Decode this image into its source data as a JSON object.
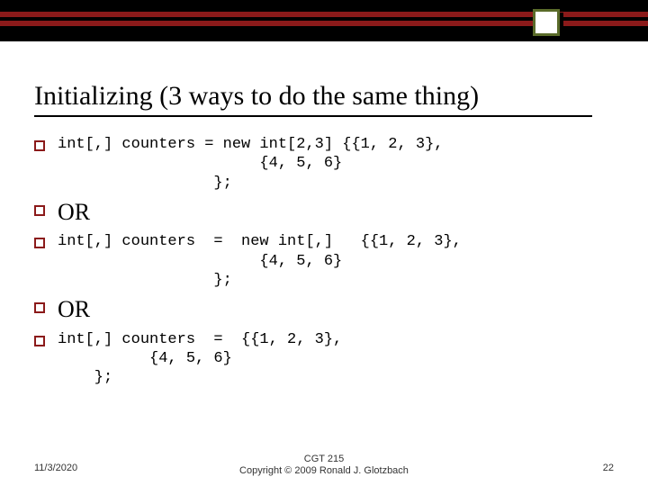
{
  "title": "Initializing (3 ways to do the same thing)",
  "items": [
    {
      "type": "code",
      "text": "int[,] counters = new int[2,3] {{1, 2, 3},\n                      {4, 5, 6}\n                 };"
    },
    {
      "type": "or",
      "text": "OR"
    },
    {
      "type": "code",
      "text": "int[,] counters  =  new int[,]   {{1, 2, 3},\n                      {4, 5, 6}\n                 };"
    },
    {
      "type": "or",
      "text": "OR"
    },
    {
      "type": "code",
      "text": "int[,] counters  =  {{1, 2, 3},\n          {4, 5, 6}\n    };"
    }
  ],
  "footer": {
    "date": "11/3/2020",
    "center_line1": "CGT 215",
    "center_line2": "Copyright © 2009 Ronald J. Glotzbach",
    "page": "22"
  }
}
